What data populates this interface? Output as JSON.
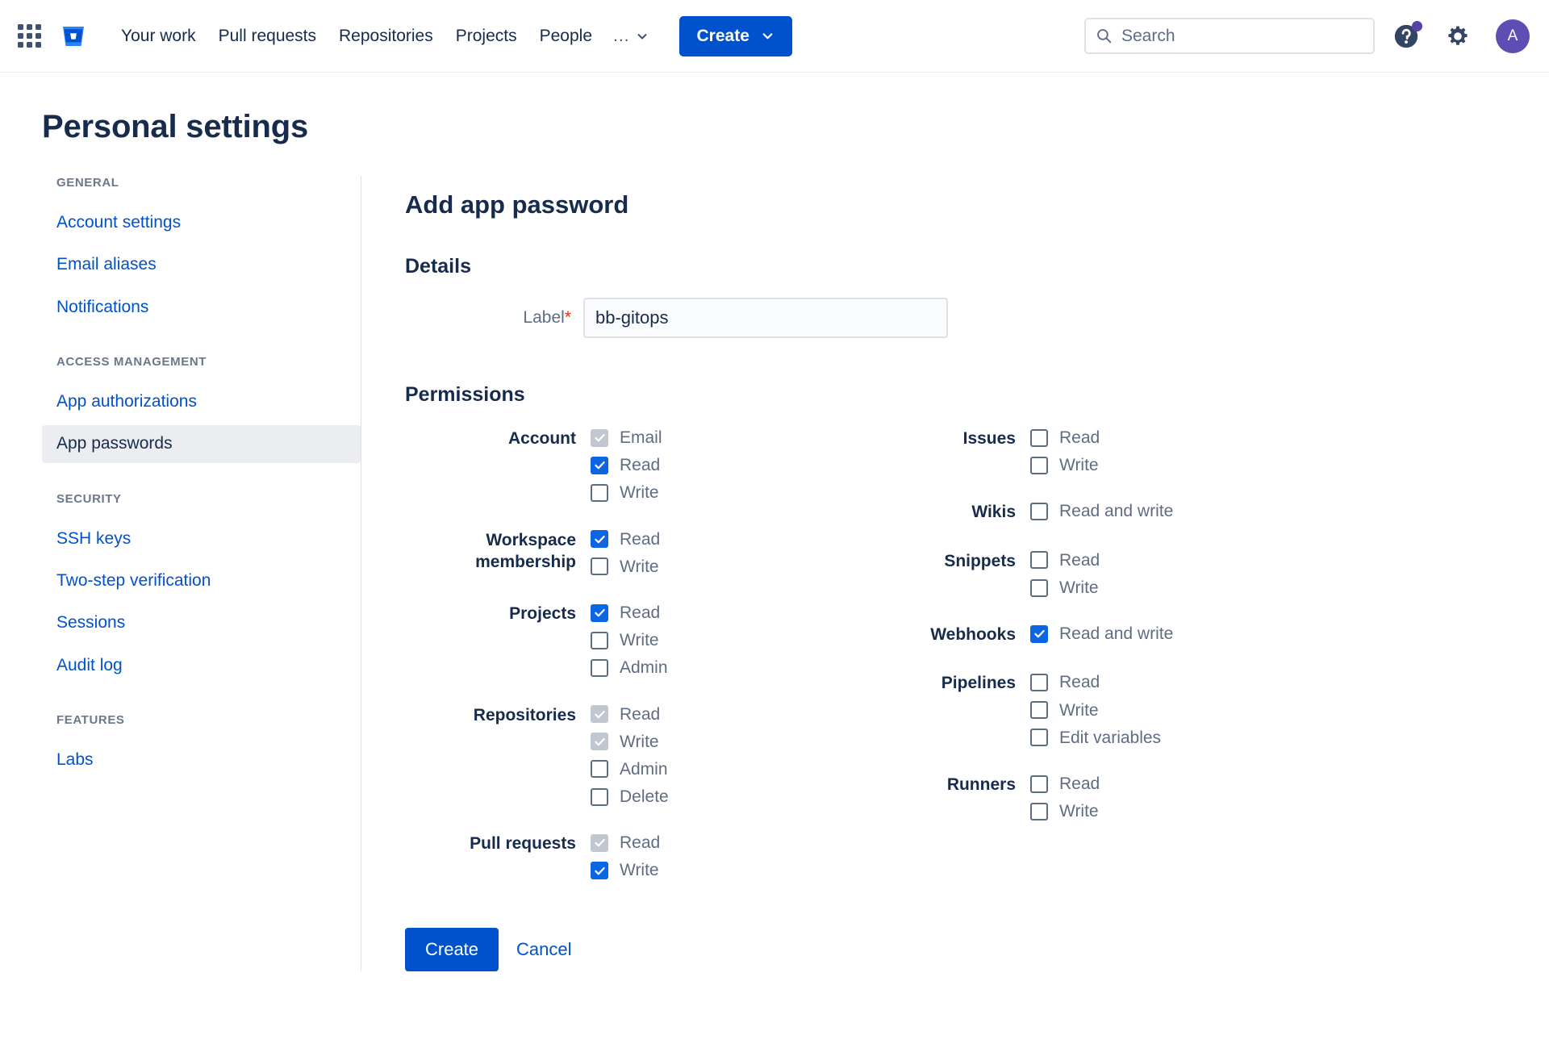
{
  "navbar": {
    "app_switcher_icon": "grid-apps-icon",
    "logo_icon": "bitbucket-logo-icon",
    "links": [
      {
        "label": "Your work"
      },
      {
        "label": "Pull requests"
      },
      {
        "label": "Repositories"
      },
      {
        "label": "Projects"
      },
      {
        "label": "People"
      }
    ],
    "more_label": "...",
    "more_icon": "chevron-down-icon",
    "create_label": "Create",
    "create_chevron_icon": "chevron-down-icon",
    "search": {
      "icon": "search-icon",
      "placeholder": "Search",
      "value": ""
    },
    "help_icon": "help-circle-icon",
    "help_badge": true,
    "settings_icon": "gear-icon",
    "avatar_initial": "A"
  },
  "page": {
    "title": "Personal settings"
  },
  "sidebar": {
    "groups": [
      {
        "label": "GENERAL",
        "items": [
          {
            "label": "Account settings",
            "selected": false
          },
          {
            "label": "Email aliases",
            "selected": false
          },
          {
            "label": "Notifications",
            "selected": false
          }
        ]
      },
      {
        "label": "ACCESS MANAGEMENT",
        "items": [
          {
            "label": "App authorizations",
            "selected": false
          },
          {
            "label": "App passwords",
            "selected": true
          }
        ]
      },
      {
        "label": "SECURITY",
        "items": [
          {
            "label": "SSH keys",
            "selected": false
          },
          {
            "label": "Two-step verification",
            "selected": false
          },
          {
            "label": "Sessions",
            "selected": false
          },
          {
            "label": "Audit log",
            "selected": false
          }
        ]
      },
      {
        "label": "FEATURES",
        "items": [
          {
            "label": "Labs",
            "selected": false
          }
        ]
      }
    ]
  },
  "main": {
    "title": "Add app password",
    "details": {
      "heading": "Details",
      "label_text": "Label",
      "required_mark": "*",
      "input_value": "bb-gitops",
      "input_placeholder": ""
    },
    "permissions": {
      "heading": "Permissions",
      "left_column": [
        {
          "name": "Account",
          "options": [
            {
              "label": "Email",
              "state": "disabled-checked"
            },
            {
              "label": "Read",
              "state": "checked"
            },
            {
              "label": "Write",
              "state": "unchecked"
            }
          ]
        },
        {
          "name": "Workspace membership",
          "options": [
            {
              "label": "Read",
              "state": "checked"
            },
            {
              "label": "Write",
              "state": "unchecked"
            }
          ]
        },
        {
          "name": "Projects",
          "options": [
            {
              "label": "Read",
              "state": "checked"
            },
            {
              "label": "Write",
              "state": "unchecked"
            },
            {
              "label": "Admin",
              "state": "unchecked"
            }
          ]
        },
        {
          "name": "Repositories",
          "options": [
            {
              "label": "Read",
              "state": "disabled-checked"
            },
            {
              "label": "Write",
              "state": "disabled-checked"
            },
            {
              "label": "Admin",
              "state": "unchecked"
            },
            {
              "label": "Delete",
              "state": "unchecked"
            }
          ]
        },
        {
          "name": "Pull requests",
          "options": [
            {
              "label": "Read",
              "state": "disabled-checked"
            },
            {
              "label": "Write",
              "state": "checked"
            }
          ]
        }
      ],
      "right_column": [
        {
          "name": "Issues",
          "options": [
            {
              "label": "Read",
              "state": "unchecked"
            },
            {
              "label": "Write",
              "state": "unchecked"
            }
          ]
        },
        {
          "name": "Wikis",
          "options": [
            {
              "label": "Read and write",
              "state": "unchecked"
            }
          ]
        },
        {
          "name": "Snippets",
          "options": [
            {
              "label": "Read",
              "state": "unchecked"
            },
            {
              "label": "Write",
              "state": "unchecked"
            }
          ]
        },
        {
          "name": "Webhooks",
          "options": [
            {
              "label": "Read and write",
              "state": "checked"
            }
          ]
        },
        {
          "name": "Pipelines",
          "options": [
            {
              "label": "Read",
              "state": "unchecked"
            },
            {
              "label": "Write",
              "state": "unchecked"
            },
            {
              "label": "Edit variables",
              "state": "unchecked"
            }
          ]
        },
        {
          "name": "Runners",
          "options": [
            {
              "label": "Read",
              "state": "unchecked"
            },
            {
              "label": "Write",
              "state": "unchecked"
            }
          ]
        }
      ]
    },
    "actions": {
      "submit_label": "Create",
      "cancel_label": "Cancel"
    }
  },
  "colors": {
    "brand_blue": "#0052CC",
    "checked_blue": "#0C66E4",
    "link_blue": "#0052CC",
    "text_dark": "#172B4D",
    "text_muted": "#5E6C84",
    "disabled_gray": "#C1C7D0",
    "selected_bg": "#EBEDF0",
    "avatar_purple": "#5E4DB2"
  }
}
